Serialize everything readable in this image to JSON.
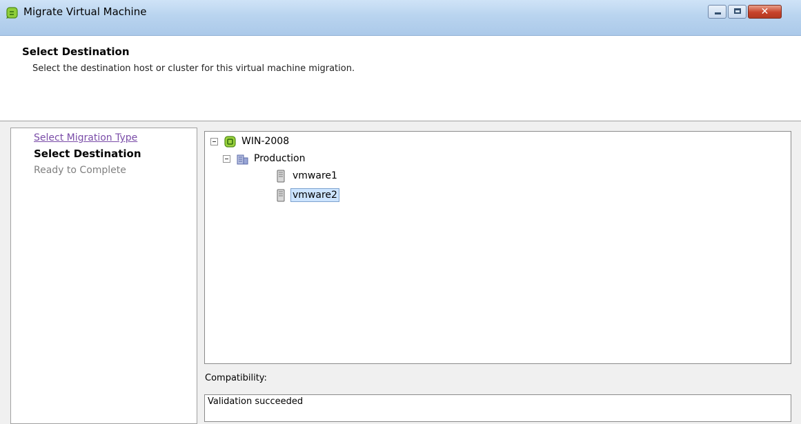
{
  "window": {
    "title": "Migrate Virtual Machine",
    "icon": "vm-migrate-icon",
    "controls": [
      "minimize-icon",
      "maximize-icon",
      "close-icon"
    ],
    "close_glyph": "✕"
  },
  "header": {
    "title": "Select Destination",
    "description": "Select the destination host or cluster for this virtual machine migration."
  },
  "steps": [
    {
      "label": "Select Migration Type",
      "state": "visited"
    },
    {
      "label": "Select Destination",
      "state": "current"
    },
    {
      "label": "Ready to Complete",
      "state": "disabled"
    }
  ],
  "tree": {
    "nodes": [
      {
        "label": "WIN-2008",
        "icon": "vcenter-icon",
        "expanded": true,
        "level": 0
      },
      {
        "label": "Production",
        "icon": "datacenter-icon",
        "expanded": true,
        "level": 1
      },
      {
        "label": "vmware1",
        "icon": "host-icon",
        "level": 2
      },
      {
        "label": "vmware2",
        "icon": "host-icon",
        "level": 2,
        "selected": true
      }
    ]
  },
  "compatibility": {
    "label": "Compatibility:",
    "value": "Validation succeeded"
  },
  "colors": {
    "titlebar": "#b9d4ef",
    "link_visited": "#7a4ca8",
    "disabled_text": "#7f7f7f",
    "selection": "#cce4ff"
  }
}
